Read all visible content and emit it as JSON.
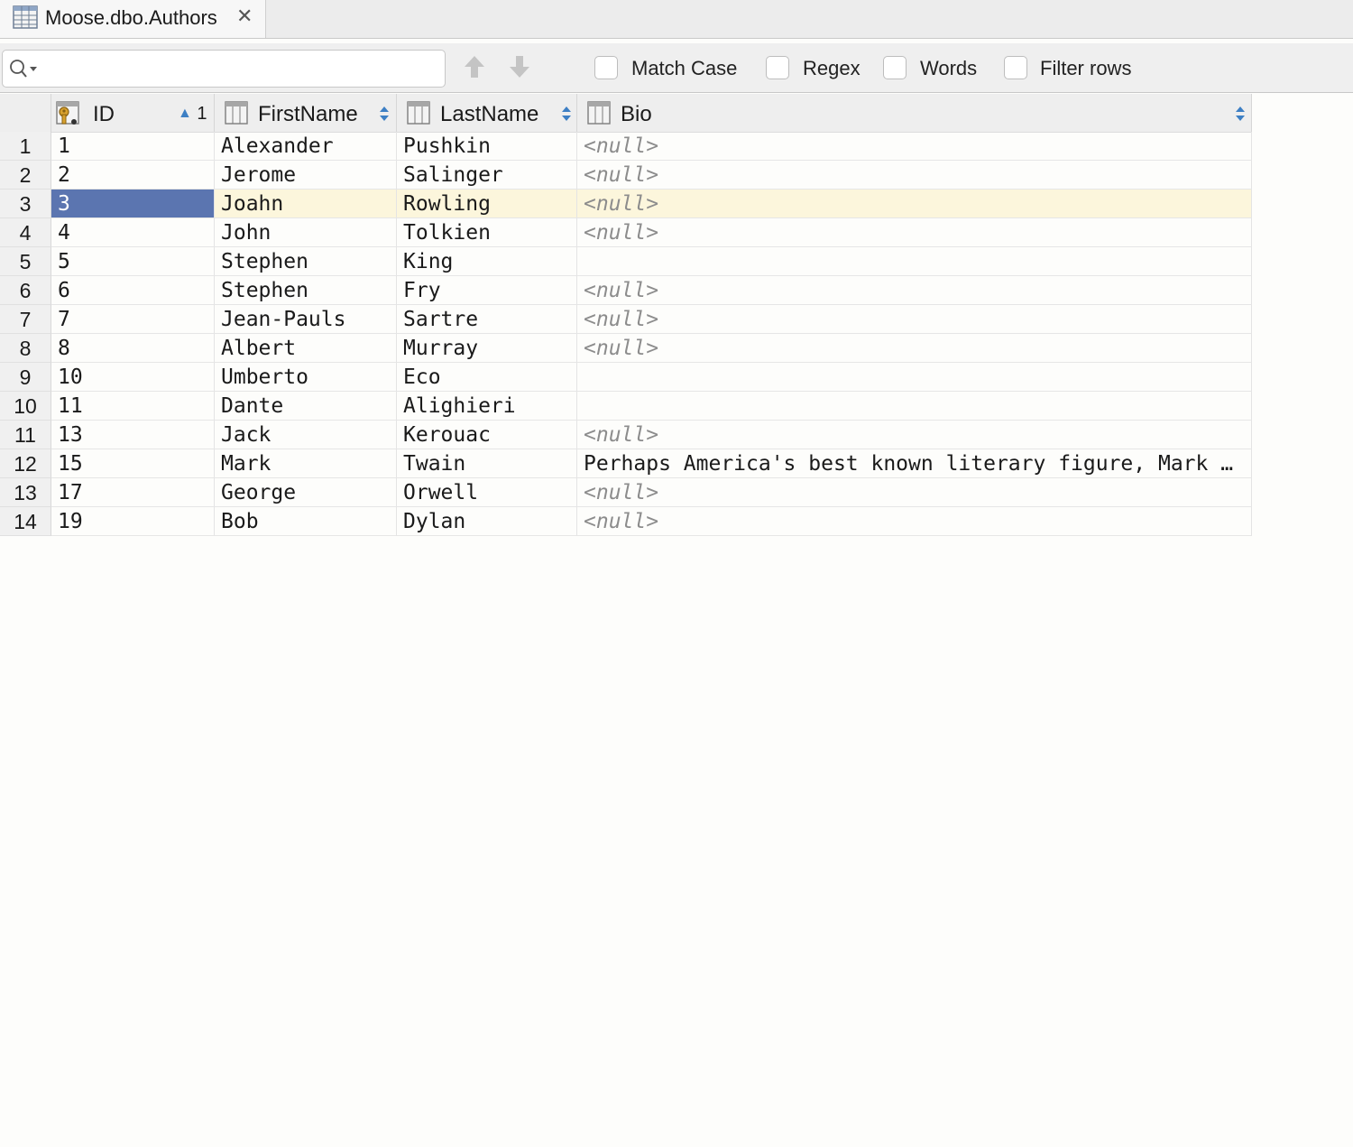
{
  "tab": {
    "title": "Moose.dbo.Authors",
    "close": "✕"
  },
  "toolbar": {
    "search_value": "",
    "search_placeholder": "",
    "options": {
      "match_case": "Match Case",
      "regex": "Regex",
      "words": "Words",
      "filter_rows": "Filter rows"
    }
  },
  "grid": {
    "columns": [
      {
        "name": "ID",
        "sort_indicator": "▲ 1",
        "key": true
      },
      {
        "name": "FirstName",
        "sort_indicator": "",
        "key": false
      },
      {
        "name": "LastName",
        "sort_indicator": "",
        "key": false
      },
      {
        "name": "Bio",
        "sort_indicator": "",
        "key": false
      }
    ],
    "selected_row_number": "3",
    "rows": [
      {
        "num": "1",
        "id": "1",
        "first": "Alexander",
        "last": "Pushkin",
        "bio": "<null>"
      },
      {
        "num": "2",
        "id": "2",
        "first": "Jerome",
        "last": "Salinger",
        "bio": "<null>"
      },
      {
        "num": "3",
        "id": "3",
        "first": "Joahn",
        "last": "Rowling",
        "bio": "<null>"
      },
      {
        "num": "4",
        "id": "4",
        "first": "John",
        "last": "Tolkien",
        "bio": "<null>"
      },
      {
        "num": "5",
        "id": "5",
        "first": "Stephen",
        "last": "King",
        "bio": ""
      },
      {
        "num": "6",
        "id": "6",
        "first": "Stephen",
        "last": "Fry",
        "bio": "<null>"
      },
      {
        "num": "7",
        "id": "7",
        "first": "Jean-Pauls",
        "last": "Sartre",
        "bio": "<null>"
      },
      {
        "num": "8",
        "id": "8",
        "first": "Albert",
        "last": "Murray",
        "bio": "<null>"
      },
      {
        "num": "9",
        "id": "10",
        "first": "Umberto",
        "last": "Eco",
        "bio": ""
      },
      {
        "num": "10",
        "id": "11",
        "first": "Dante",
        "last": "Alighieri",
        "bio": ""
      },
      {
        "num": "11",
        "id": "13",
        "first": "Jack",
        "last": "Kerouac",
        "bio": "<null>"
      },
      {
        "num": "12",
        "id": "15",
        "first": "Mark",
        "last": "Twain",
        "bio": "Perhaps America's best known literary figure, Mark …"
      },
      {
        "num": "13",
        "id": "17",
        "first": "George",
        "last": "Orwell",
        "bio": "<null>"
      },
      {
        "num": "14",
        "id": "19",
        "first": "Bob",
        "last": "Dylan",
        "bio": "<null>"
      }
    ]
  },
  "colors": {
    "selection": "#5b75b0",
    "current_row": "#fcf6dc",
    "null_text": "#8c8c8c",
    "sort_arrow": "#3d7fc4"
  }
}
